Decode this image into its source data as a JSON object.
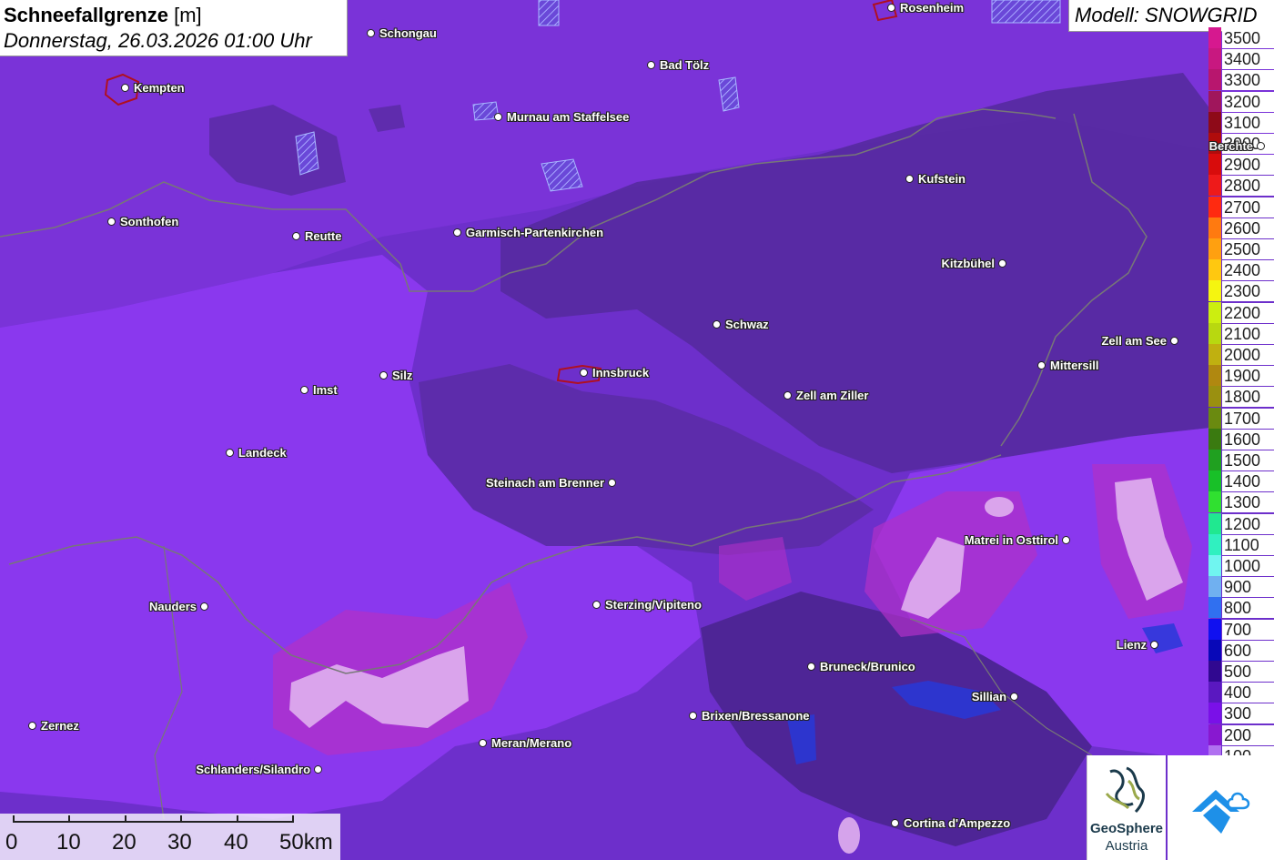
{
  "header": {
    "title": "Schneefallgrenze",
    "unit": "[m]",
    "datetime": "Donnerstag, 26.03.2026 01:00 Uhr",
    "model": "Modell: SNOWGRID"
  },
  "legend": [
    {
      "label": "3500",
      "color": "#d6188f"
    },
    {
      "label": "3400",
      "color": "#c81880"
    },
    {
      "label": "3300",
      "color": "#b8166e"
    },
    {
      "label": "3200",
      "color": "#a0165c"
    },
    {
      "label": "3100",
      "color": "#8e0a18"
    },
    {
      "label": "3000",
      "color": "#b00c0c"
    },
    {
      "label": "2900",
      "color": "#d80c0c"
    },
    {
      "label": "2800",
      "color": "#ee1a1a"
    },
    {
      "label": "2700",
      "color": "#ff2a10"
    },
    {
      "label": "2600",
      "color": "#ff7a10"
    },
    {
      "label": "2500",
      "color": "#ffa010"
    },
    {
      "label": "2400",
      "color": "#ffc810"
    },
    {
      "label": "2300",
      "color": "#f5f510"
    },
    {
      "label": "2200",
      "color": "#ccee10"
    },
    {
      "label": "2100",
      "color": "#b8d810"
    },
    {
      "label": "2000",
      "color": "#c0b010"
    },
    {
      "label": "1900",
      "color": "#b08810"
    },
    {
      "label": "1800",
      "color": "#9a9010"
    },
    {
      "label": "1700",
      "color": "#6a8a10"
    },
    {
      "label": "1600",
      "color": "#3a7a10"
    },
    {
      "label": "1500",
      "color": "#20a020"
    },
    {
      "label": "1400",
      "color": "#18c028"
    },
    {
      "label": "1300",
      "color": "#30e030"
    },
    {
      "label": "1200",
      "color": "#20e890"
    },
    {
      "label": "1100",
      "color": "#30f0c0"
    },
    {
      "label": "1000",
      "color": "#70f5f0"
    },
    {
      "label": "900",
      "color": "#70b0f0"
    },
    {
      "label": "800",
      "color": "#3070f0"
    },
    {
      "label": "700",
      "color": "#1010f0"
    },
    {
      "label": "600",
      "color": "#0808b8"
    },
    {
      "label": "500",
      "color": "#300890"
    },
    {
      "label": "400",
      "color": "#5a18c0"
    },
    {
      "label": "300",
      "color": "#7a10e8"
    },
    {
      "label": "200",
      "color": "#8818d0"
    },
    {
      "label": "100",
      "color": "#b070f0"
    }
  ],
  "cities": [
    {
      "name": "Schongau"
    },
    {
      "name": "Rosenheim"
    },
    {
      "name": "Kempten"
    },
    {
      "name": "Bad Tölz"
    },
    {
      "name": "Murnau am Staffelsee"
    },
    {
      "name": "Berchte"
    },
    {
      "name": "Kufstein"
    },
    {
      "name": "Sonthofen"
    },
    {
      "name": "Reutte"
    },
    {
      "name": "Garmisch-Partenkirchen"
    },
    {
      "name": "Kitzbühel"
    },
    {
      "name": "Schwaz"
    },
    {
      "name": "Zell am See"
    },
    {
      "name": "Mittersill"
    },
    {
      "name": "Innsbruck"
    },
    {
      "name": "Silz"
    },
    {
      "name": "Imst"
    },
    {
      "name": "Zell am Ziller"
    },
    {
      "name": "Landeck"
    },
    {
      "name": "Steinach am Brenner"
    },
    {
      "name": "Matrei in Osttirol"
    },
    {
      "name": "Nauders"
    },
    {
      "name": "Sterzing/Vipiteno"
    },
    {
      "name": "Lienz"
    },
    {
      "name": "Bruneck/Brunico"
    },
    {
      "name": "Sillian"
    },
    {
      "name": "Brixen/Bressanone"
    },
    {
      "name": "Zernez"
    },
    {
      "name": "Meran/Merano"
    },
    {
      "name": "Schlanders/Silandro"
    },
    {
      "name": "Cortina d'Ampezzo"
    }
  ],
  "scalebar": {
    "ticks": [
      "0",
      "10",
      "20",
      "30",
      "40",
      "50km"
    ]
  },
  "logos": {
    "geosphere_name": "GeoSphere",
    "geosphere_sub": "Austria"
  }
}
